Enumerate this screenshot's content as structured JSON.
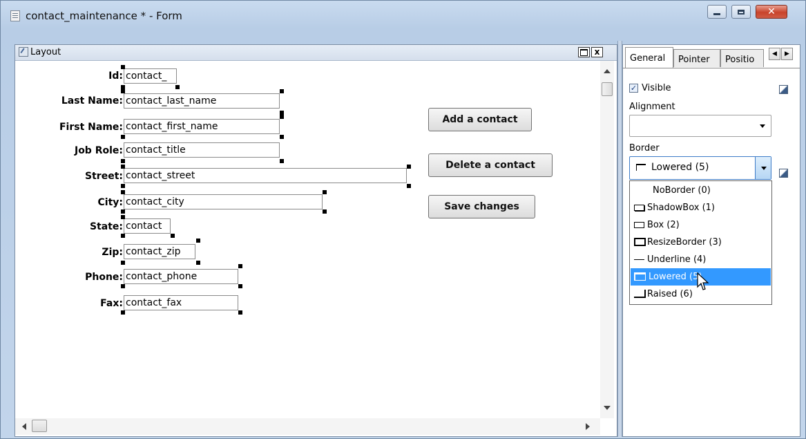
{
  "window": {
    "title": "contact_maintenance * - Form",
    "app_icon": "form-document-icon"
  },
  "layout_pane": {
    "title": "Layout",
    "icon": "layout-pencil-icon",
    "maximize_icon": "maximize-icon",
    "close_glyph": "x"
  },
  "fields": [
    {
      "label": "Id:",
      "value": "contact_"
    },
    {
      "label": "Last Name:",
      "value": "contact_last_name"
    },
    {
      "label": "First Name:",
      "value": "contact_first_name"
    },
    {
      "label": "Job Role:",
      "value": "contact_title"
    },
    {
      "label": "Street:",
      "value": "contact_street"
    },
    {
      "label": "City:",
      "value": "contact_city"
    },
    {
      "label": "State:",
      "value": "contact"
    },
    {
      "label": "Zip:",
      "value": "contact_zip"
    },
    {
      "label": "Phone:",
      "value": "contact_phone"
    },
    {
      "label": "Fax:",
      "value": "contact_fax"
    }
  ],
  "buttons": {
    "add": "Add a contact",
    "delete": "Delete a contact",
    "save": "Save changes"
  },
  "properties": {
    "tabs": [
      "General",
      "Pointer",
      "Positio"
    ],
    "visible_label": "Visible",
    "visible_checked": true,
    "alignment_label": "Alignment",
    "alignment_value": "",
    "border_label": "Border",
    "border_value": "Lowered (5)",
    "border_options": [
      {
        "label": "NoBorder (0)",
        "icon": "none"
      },
      {
        "label": "ShadowBox (1)",
        "icon": "shadowbox-icon"
      },
      {
        "label": "Box (2)",
        "icon": "box-icon"
      },
      {
        "label": "ResizeBorder (3)",
        "icon": "resizeborder-icon"
      },
      {
        "label": "Underline (4)",
        "icon": "underline-icon"
      },
      {
        "label": "Lowered (5)",
        "icon": "lowered-icon",
        "selected": true
      },
      {
        "label": "Raised (6)",
        "icon": "raised-icon"
      }
    ],
    "highlight_color": "#3399ff"
  }
}
